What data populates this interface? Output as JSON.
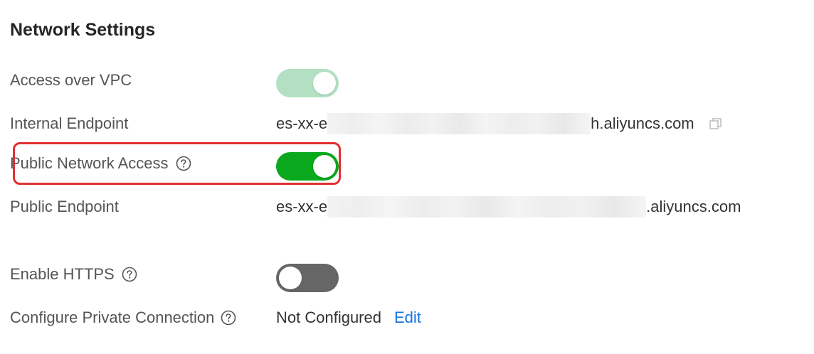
{
  "section_title": "Network Settings",
  "rows": {
    "vpc": {
      "label": "Access over VPC",
      "enabled": true,
      "switch_disabled": true
    },
    "internal_endpoint": {
      "label": "Internal Endpoint",
      "prefix": "es-xx-e",
      "suffix": "h.aliyuncs.com"
    },
    "public_access": {
      "label": "Public Network Access",
      "enabled": true
    },
    "public_endpoint": {
      "label": "Public Endpoint",
      "prefix": "es-xx-e",
      "suffix": ".aliyuncs.com"
    },
    "https": {
      "label": "Enable HTTPS",
      "enabled": false
    },
    "private_connection": {
      "label": "Configure Private Connection",
      "status": "Not Configured",
      "edit_label": "Edit"
    }
  },
  "colors": {
    "switch_on": "#0aa81d",
    "switch_on_disabled": "#b3e0c2",
    "switch_off": "#666666",
    "link": "#1a73e8",
    "highlight": "#e03030"
  },
  "icons": {
    "help": "help-circle-icon",
    "copy": "copy-icon"
  }
}
